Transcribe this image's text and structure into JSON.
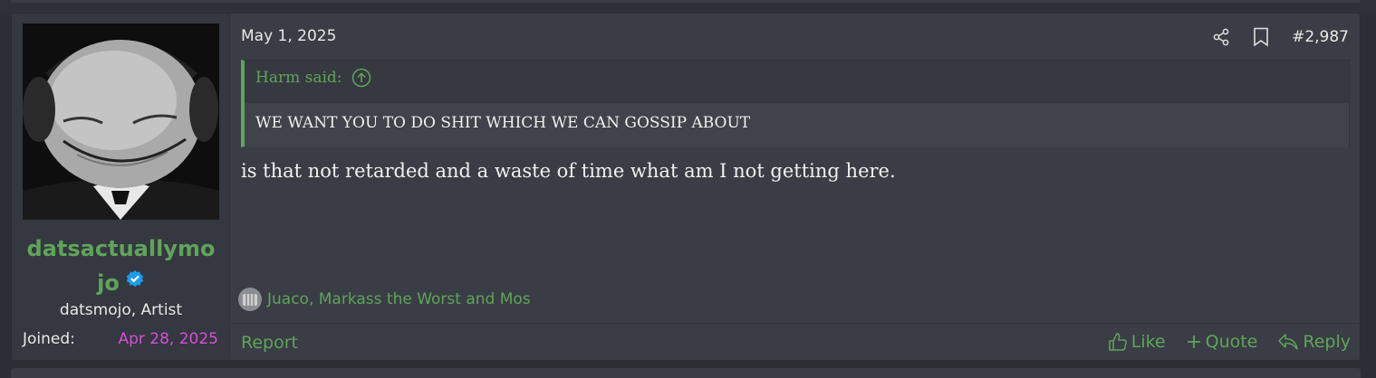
{
  "post": {
    "user": {
      "name_line1": "datsactuallymo",
      "name_line2": "jo",
      "title": "datsmojo, Artist",
      "joined_label": "Joined:",
      "joined_value": "Apr 28, 2025"
    },
    "date": "May 1, 2025",
    "number": "#2,987",
    "quote": {
      "author_label": "Harm said:",
      "text": "WE WANT YOU TO DO SHIT WHICH WE CAN GOSSIP ABOUT"
    },
    "message": "is that not retarded and a waste of time what am I not getting here.",
    "reactions_text": "Juaco, Markass the Worst and Mos",
    "report_label": "Report",
    "like_label": "Like",
    "quote_label": "Quote",
    "reply_label": "Reply"
  },
  "colors": {
    "accent": "#5fa45a",
    "joined": "#d64fd6",
    "verified": "#1d9bf0"
  },
  "icons": [
    "share-icon",
    "bookmark-icon",
    "arrow-up-circle-icon",
    "verified-badge-icon",
    "thumbs-up-icon",
    "plus-icon",
    "reply-icon"
  ]
}
